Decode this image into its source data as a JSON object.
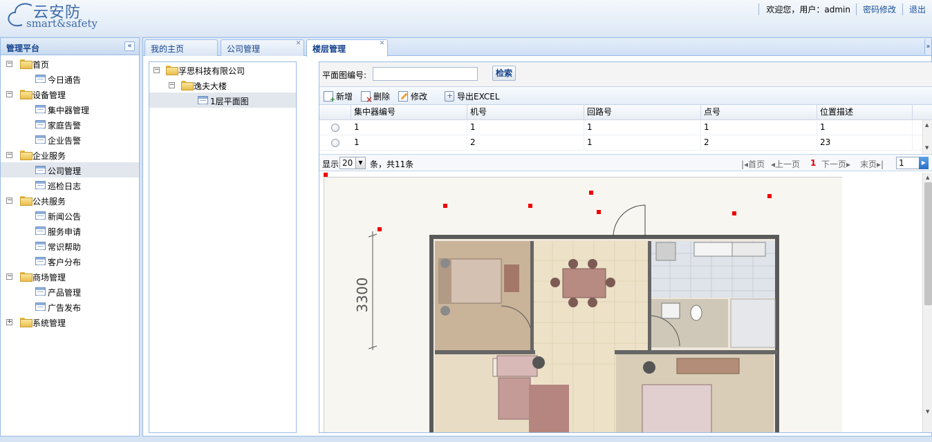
{
  "app": {
    "logo_title": "云安防",
    "logo_subtitle": "smart&safety"
  },
  "userbar": {
    "greeting": "欢迎您，用户：admin",
    "change_password": "密码修改",
    "logout": "退出"
  },
  "sidebar": {
    "title": "管理平台",
    "collapse_icon": "double-chevron-left-icon",
    "items": [
      {
        "label": "首页",
        "type": "folder",
        "expanded": true
      },
      {
        "label": "今日通告",
        "type": "page"
      },
      {
        "label": "设备管理",
        "type": "folder",
        "expanded": true
      },
      {
        "label": "集中器管理",
        "type": "page"
      },
      {
        "label": "家庭告警",
        "type": "page"
      },
      {
        "label": "企业告警",
        "type": "page"
      },
      {
        "label": "企业服务",
        "type": "folder",
        "expanded": true
      },
      {
        "label": "公司管理",
        "type": "page",
        "selected": true
      },
      {
        "label": "巡检日志",
        "type": "page"
      },
      {
        "label": "公共服务",
        "type": "folder",
        "expanded": true
      },
      {
        "label": "新闻公告",
        "type": "page"
      },
      {
        "label": "服务申请",
        "type": "page"
      },
      {
        "label": "常识帮助",
        "type": "page"
      },
      {
        "label": "客户分布",
        "type": "page"
      },
      {
        "label": "商场管理",
        "type": "folder",
        "expanded": true
      },
      {
        "label": "产品管理",
        "type": "page"
      },
      {
        "label": "广告发布",
        "type": "page"
      },
      {
        "label": "系统管理",
        "type": "folder",
        "expanded": false
      }
    ]
  },
  "tabs": [
    {
      "label": "我的主页",
      "closable": false,
      "active": false
    },
    {
      "label": "公司管理",
      "closable": true,
      "active": false
    },
    {
      "label": "楼层管理",
      "closable": true,
      "active": true
    }
  ],
  "building_tree": [
    {
      "label": "孚思科技有限公司",
      "type": "folder",
      "expanded": true
    },
    {
      "label": "逸夫大楼",
      "type": "folder",
      "expanded": true
    },
    {
      "label": "1层平面图",
      "type": "page",
      "selected": true
    }
  ],
  "search": {
    "label": "平面图编号:",
    "value": "",
    "placeholder": "",
    "button": "检索"
  },
  "toolbar": {
    "add": "新增",
    "delete": "删除",
    "edit": "修改",
    "export": "导出EXCEL"
  },
  "table": {
    "columns": [
      "集中器编号",
      "机号",
      "回路号",
      "点号",
      "位置描述"
    ],
    "rows": [
      [
        "1",
        "1",
        "1",
        "1",
        "1"
      ],
      [
        "1",
        "2",
        "1",
        "2",
        "23"
      ]
    ]
  },
  "pager": {
    "show_label": "显示",
    "page_size": "20",
    "count_text": "条，共11条",
    "first": "首页",
    "prev": "上一页",
    "current": "1",
    "next": "下一页",
    "last": "末页",
    "page_input": "1"
  },
  "floorplan": {
    "dimension_label": "3300",
    "marker_color": "#ee0000"
  }
}
